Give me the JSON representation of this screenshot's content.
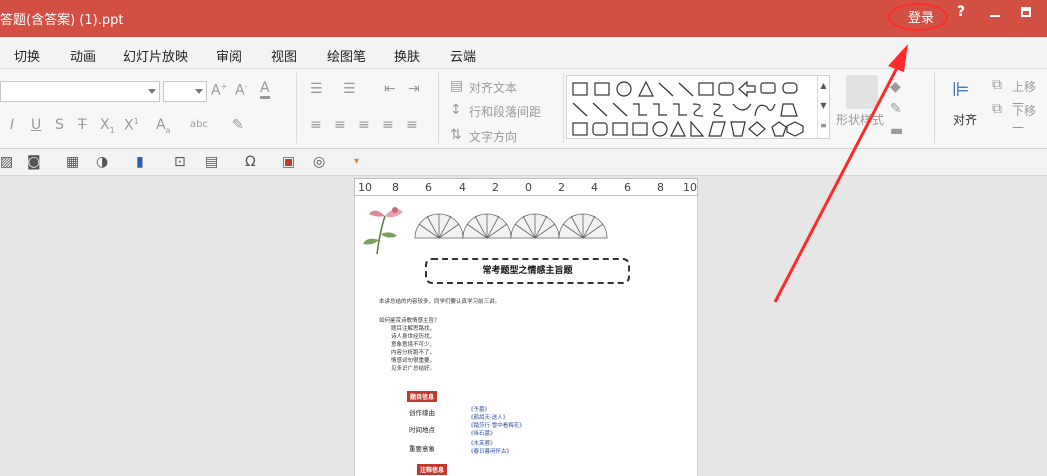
{
  "titlebar": {
    "title": "答题(含答案) (1).ppt",
    "login": "登录",
    "help": "?"
  },
  "menu": [
    "切换",
    "动画",
    "幻灯片放映",
    "审阅",
    "视图",
    "绘图笔",
    "换肤",
    "云端"
  ],
  "ribbon": {
    "align_text": "对齐文本",
    "line_spacing": "行和段落间距",
    "text_direction": "文字方向",
    "shape_style": "形状样式",
    "align": "对齐",
    "move_up": "上移一",
    "move_down": "下移一"
  },
  "ruler": [
    "10",
    "8",
    "6",
    "4",
    "2",
    "0",
    "2",
    "4",
    "6",
    "8",
    "10"
  ],
  "document": {
    "title": "常考题型之情感主旨题",
    "intro": "本讲总结的内容较多，同学们要认真学习前三讲。",
    "question": "如何鉴赏诗歌情感主旨？",
    "lines": [
      "题目注解思路找，",
      "诗人身世经历找，",
      "意象意境不可少，",
      "内容分析跑不了，",
      "情感词句很重要，",
      "见多识广总结好。"
    ],
    "tag1": "题目信息",
    "fields": [
      "创作缘由",
      "时间地点",
      "重要意象"
    ],
    "links": [
      "《予墓》",
      "《鹧鸪天·送人》",
      "《踏莎行·雪中看梅花》",
      "《咏石墓》",
      "《木芙蓉》",
      "《春日暮闲怀古》"
    ],
    "tag2": "注释信息"
  },
  "colors": {
    "brand": "#d24f44",
    "annotation": "#ff2a2a"
  }
}
